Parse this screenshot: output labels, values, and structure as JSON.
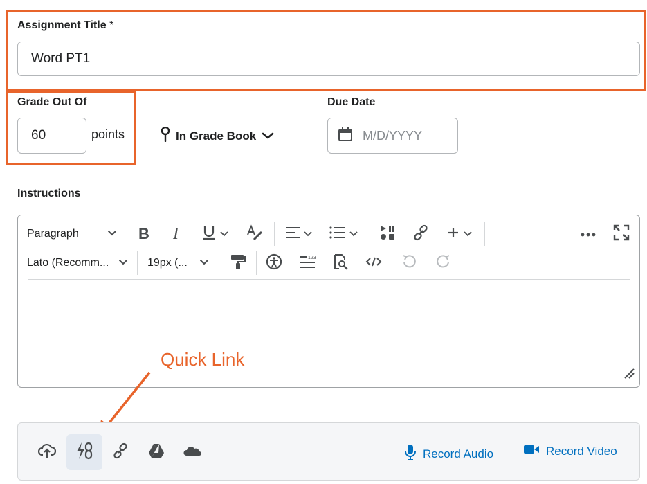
{
  "assignment_title": {
    "label": "Assignment Title",
    "required_marker": "*",
    "value": "Word PT1"
  },
  "grade": {
    "label": "Grade Out Of",
    "value": "60",
    "unit": "points",
    "grade_book_label": "In Grade Book"
  },
  "due_date": {
    "label": "Due Date",
    "placeholder": "M/D/YYYY"
  },
  "instructions": {
    "label": "Instructions",
    "toolbar": {
      "paragraph_format": "Paragraph",
      "font_family": "Lato (Recomm...",
      "font_size": "19px (..."
    },
    "content": ""
  },
  "attachments": {
    "record_audio_label": "Record Audio",
    "record_video_label": "Record Video"
  },
  "annotation": {
    "text": "Quick Link"
  },
  "colors": {
    "highlight": "#e8642b",
    "link_blue": "#006fbf",
    "text": "#202122",
    "icon": "#494c4e"
  },
  "icons": [
    "calendar-icon",
    "map-pin-icon",
    "bold-icon",
    "italic-icon",
    "underline-icon",
    "clear-format-icon",
    "align-icon",
    "list-icon",
    "insert-media-icon",
    "insert-link-icon",
    "insert-plus-icon",
    "more-icon",
    "fullscreen-icon",
    "format-painter-icon",
    "accessibility-icon",
    "line-spacing-icon",
    "find-replace-icon",
    "source-code-icon",
    "undo-icon",
    "redo-icon",
    "upload-icon",
    "quick-link-icon",
    "link-icon",
    "google-drive-icon",
    "onedrive-icon",
    "microphone-icon",
    "video-camera-icon"
  ]
}
